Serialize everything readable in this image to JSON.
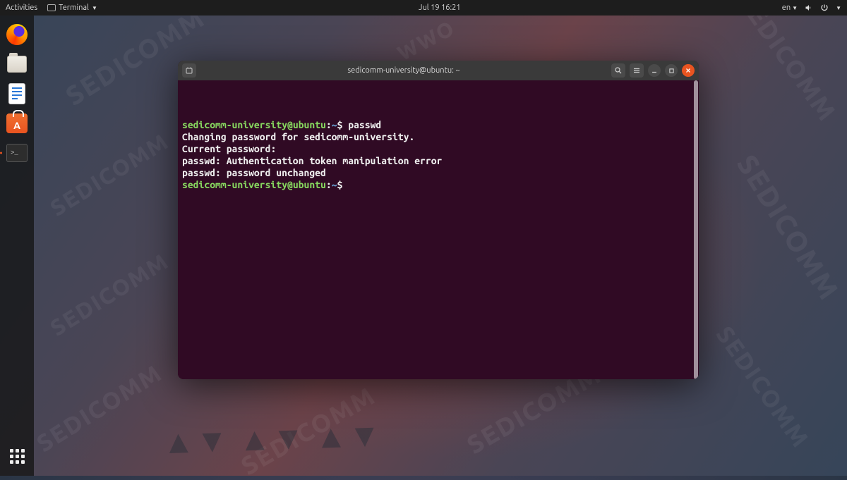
{
  "topbar": {
    "activities": "Activities",
    "app_menu": "Terminal",
    "datetime": "Jul 19  16:21",
    "lang": "en"
  },
  "terminal_window": {
    "title": "sedicomm-university@ubuntu: ~"
  },
  "terminal": {
    "prompt": {
      "user": "sedicomm-university",
      "at": "@",
      "host": "ubuntu",
      "colon": ":",
      "path": "~",
      "symbol": "$"
    },
    "lines": [
      {
        "type": "prompt",
        "cmd": "passwd"
      },
      {
        "type": "out",
        "text": "Changing password for sedicomm-university."
      },
      {
        "type": "out",
        "text": "Current password: "
      },
      {
        "type": "out",
        "text": "passwd: Authentication token manipulation error"
      },
      {
        "type": "out",
        "text": "passwd: password unchanged"
      },
      {
        "type": "prompt",
        "cmd": ""
      }
    ]
  }
}
